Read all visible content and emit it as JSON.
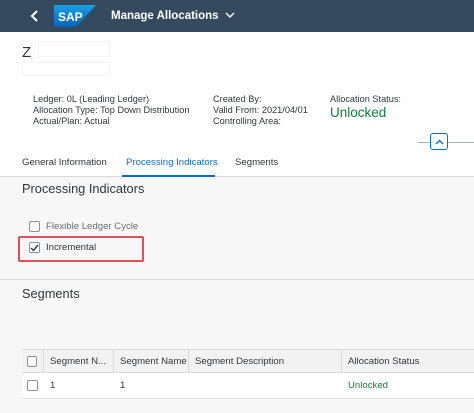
{
  "shell": {
    "logo_text": "SAP",
    "app_title": "Manage Allocations"
  },
  "header": {
    "object_title": "Z",
    "col1": {
      "ledger": "Ledger: 0L (Leading Ledger)",
      "allocation_type": "Allocation Type: Top Down Distribution",
      "actual_plan": "Actual/Plan: Actual"
    },
    "col2": {
      "created_by": "Created By:",
      "valid_from": "Valid From: 2021/04/01",
      "controlling_area": "Controlling Area:"
    },
    "col3": {
      "status_label": "Allocation Status:",
      "status_value": "Unlocked"
    }
  },
  "tabs": [
    {
      "label": "General Information"
    },
    {
      "label": "Processing Indicators"
    },
    {
      "label": "Segments"
    }
  ],
  "processing": {
    "title": "Processing Indicators",
    "flexible_label": "Flexible Ledger Cycle",
    "flexible_checked": false,
    "incremental_label": "Incremental",
    "incremental_checked": true
  },
  "segments": {
    "title": "Segments",
    "columns": [
      "Segment N...",
      "Segment Name",
      "Segment Description",
      "Allocation Status"
    ],
    "rows": [
      {
        "number": "1",
        "name": "1",
        "description": "",
        "status": "Unlocked"
      }
    ]
  },
  "colors": {
    "shell_bg": "#354a5f",
    "accent": "#0a6ed1",
    "positive": "#107e3e",
    "highlight_box": "#e05252"
  }
}
